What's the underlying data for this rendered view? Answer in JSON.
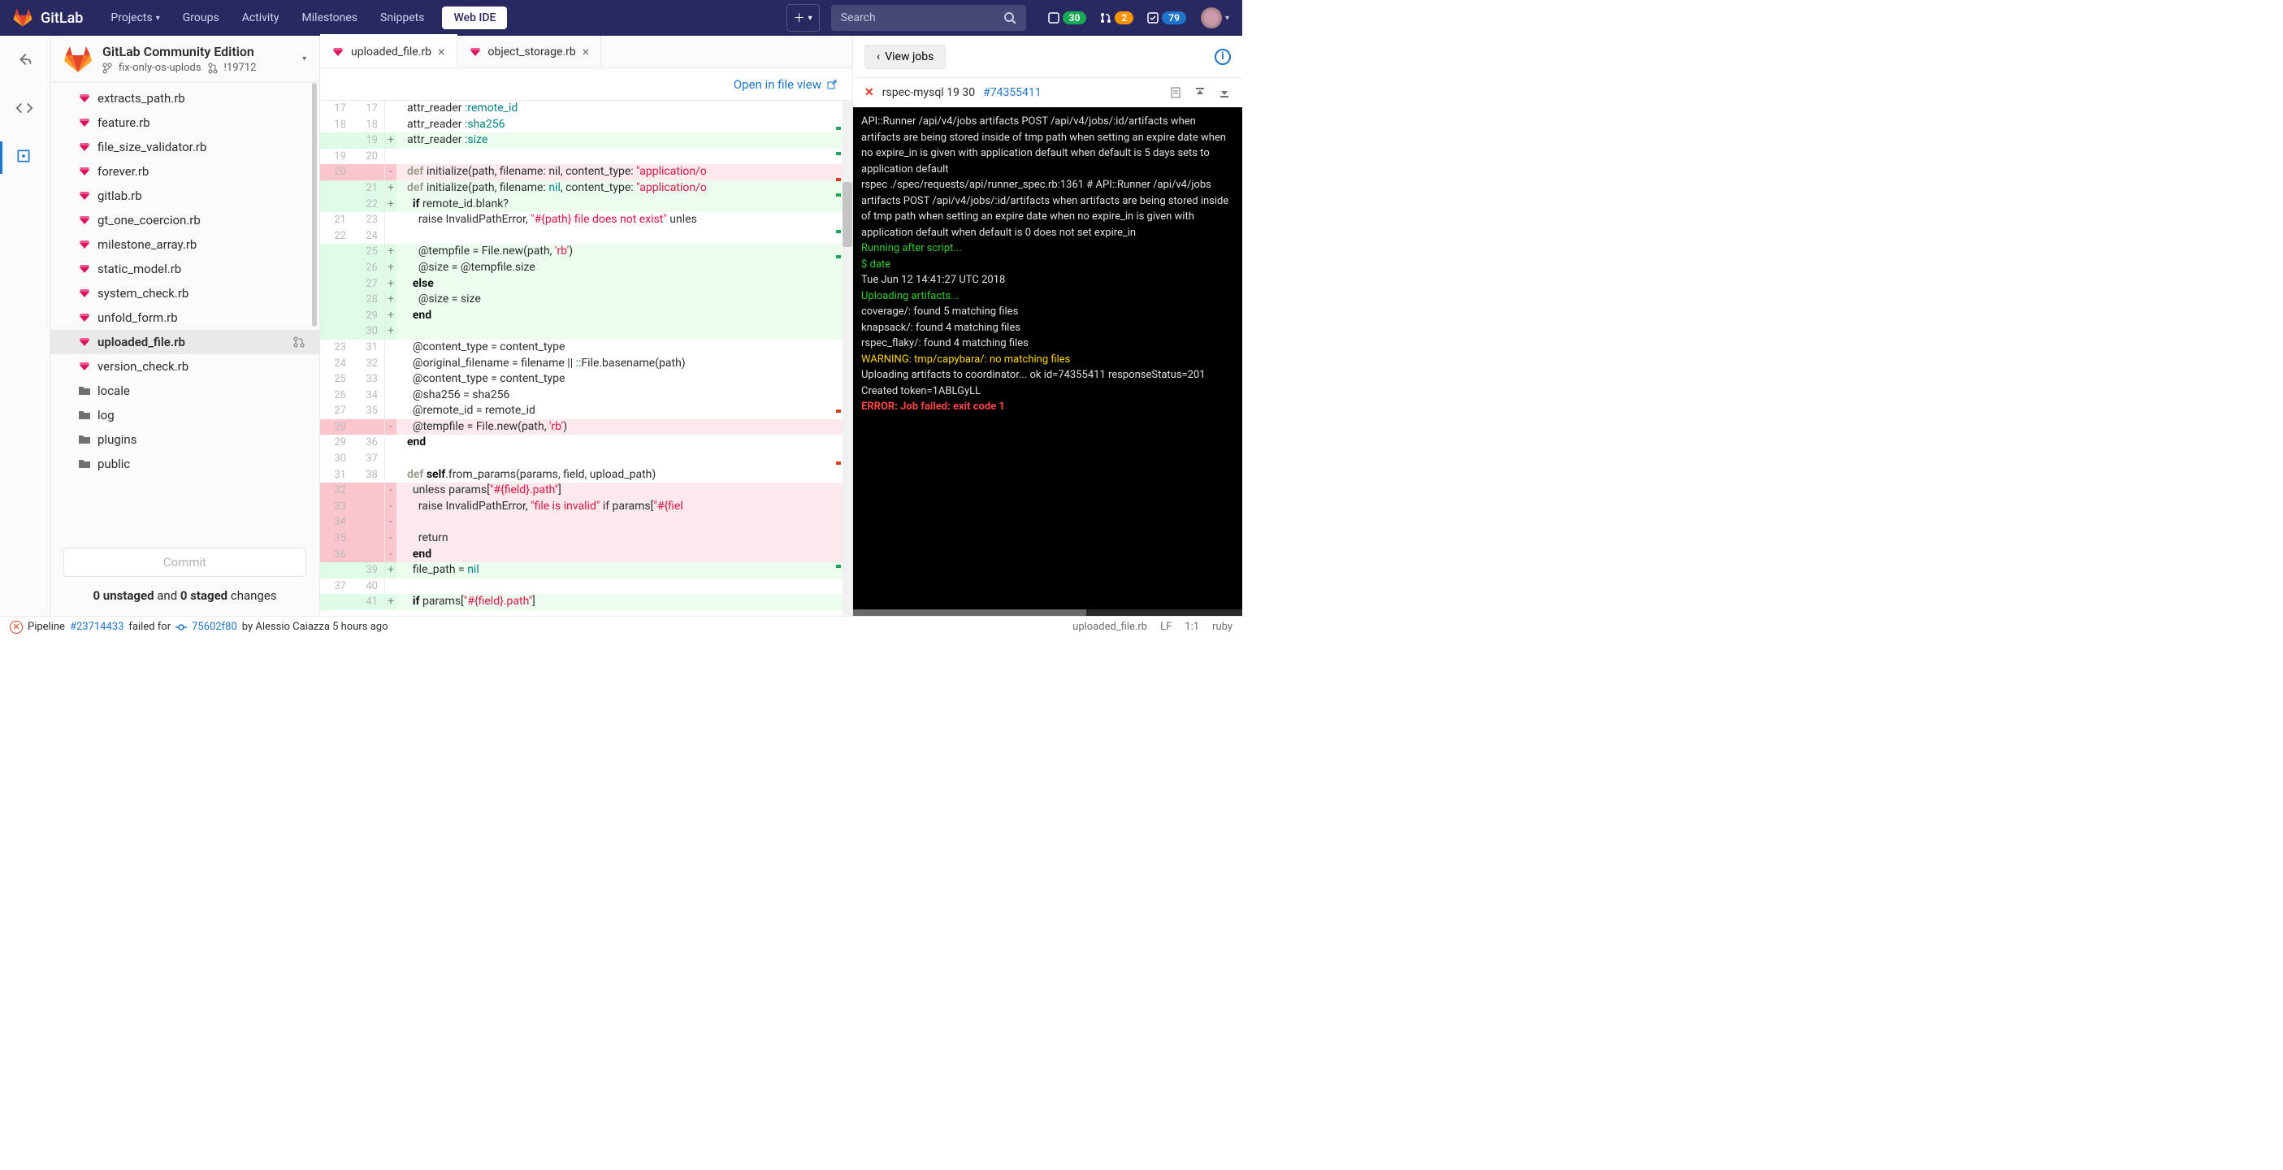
{
  "nav": {
    "brand": "GitLab",
    "items": [
      "Projects",
      "Groups",
      "Activity",
      "Milestones",
      "Snippets"
    ],
    "webide": "Web IDE",
    "search_ph": "Search",
    "badge_issues": "30",
    "badge_mr": "2",
    "badge_todo": "79"
  },
  "project": {
    "title": "GitLab Community Edition",
    "branch": "fix-only-os-uplods",
    "mr": "!19712"
  },
  "files": [
    {
      "name": "extracts_path.rb",
      "t": "ruby"
    },
    {
      "name": "feature.rb",
      "t": "ruby"
    },
    {
      "name": "file_size_validator.rb",
      "t": "ruby"
    },
    {
      "name": "forever.rb",
      "t": "ruby"
    },
    {
      "name": "gitlab.rb",
      "t": "ruby"
    },
    {
      "name": "gt_one_coercion.rb",
      "t": "ruby"
    },
    {
      "name": "milestone_array.rb",
      "t": "ruby"
    },
    {
      "name": "static_model.rb",
      "t": "ruby"
    },
    {
      "name": "system_check.rb",
      "t": "ruby"
    },
    {
      "name": "unfold_form.rb",
      "t": "ruby"
    },
    {
      "name": "uploaded_file.rb",
      "t": "ruby",
      "sel": true,
      "mr": true
    },
    {
      "name": "version_check.rb",
      "t": "ruby"
    },
    {
      "name": "locale",
      "t": "dir"
    },
    {
      "name": "log",
      "t": "dir"
    },
    {
      "name": "plugins",
      "t": "dir"
    },
    {
      "name": "public",
      "t": "dir"
    }
  ],
  "commit": {
    "btn": "Commit",
    "changes_a": "0 unstaged",
    "changes_mid": " and ",
    "changes_b": "0 staged",
    "changes_tail": " changes"
  },
  "tabs": [
    {
      "name": "uploaded_file.rb",
      "active": true
    },
    {
      "name": "object_storage.rb"
    }
  ],
  "open_link": "Open in file view",
  "jobs": {
    "view_btn": "View jobs",
    "job_name": "rspec-mysql 19 30",
    "job_hash": "#74355411"
  },
  "term_lines": [
    {
      "c": "",
      "t": "API::Runner /api/v4/jobs artifacts POST /api/v4/jobs/:id/artifacts when artifacts are being stored inside of tmp path when setting an expire date when no expire_in is given with application default when default is 5 days sets to application default"
    },
    {
      "c": "",
      "t": "rspec ./spec/requests/api/runner_spec.rb:1361 # API::Runner /api/v4/jobs artifacts POST /api/v4/jobs/:id/artifacts when artifacts are being stored inside of tmp path when setting an expire date when no expire_in is given with application default when default is 0 does not set expire_in"
    },
    {
      "c": "",
      "t": ""
    },
    {
      "c": "t-green",
      "t": "Running after script..."
    },
    {
      "c": "t-green",
      "t": "$ date"
    },
    {
      "c": "",
      "t": "Tue Jun 12 14:41:27 UTC 2018"
    },
    {
      "c": "t-green",
      "t": "Uploading artifacts..."
    },
    {
      "c": "",
      "t": "coverage/: found 5 matching files"
    },
    {
      "c": "",
      "t": "knapsack/: found 4 matching files"
    },
    {
      "c": "",
      "t": "rspec_flaky/: found 4 matching files"
    },
    {
      "c": "t-yellow",
      "t": "WARNING: tmp/capybara/: no matching files"
    },
    {
      "c": "",
      "t": "Uploading artifacts to coordinator... ok  id=74355411 responseStatus=201 Created token=1ABLGyLL"
    },
    {
      "c": "t-red",
      "t": "ERROR: Job failed: exit code 1"
    }
  ],
  "status": {
    "pre": "Pipeline ",
    "pipeline": "#23714433",
    "mid": " failed for ",
    "commit": "75602f80",
    "by": " by Alessio Caiazza 5 hours ago",
    "file": "uploaded_file.rb",
    "lf": "LF",
    "pos": "1:1",
    "lang": "ruby"
  }
}
